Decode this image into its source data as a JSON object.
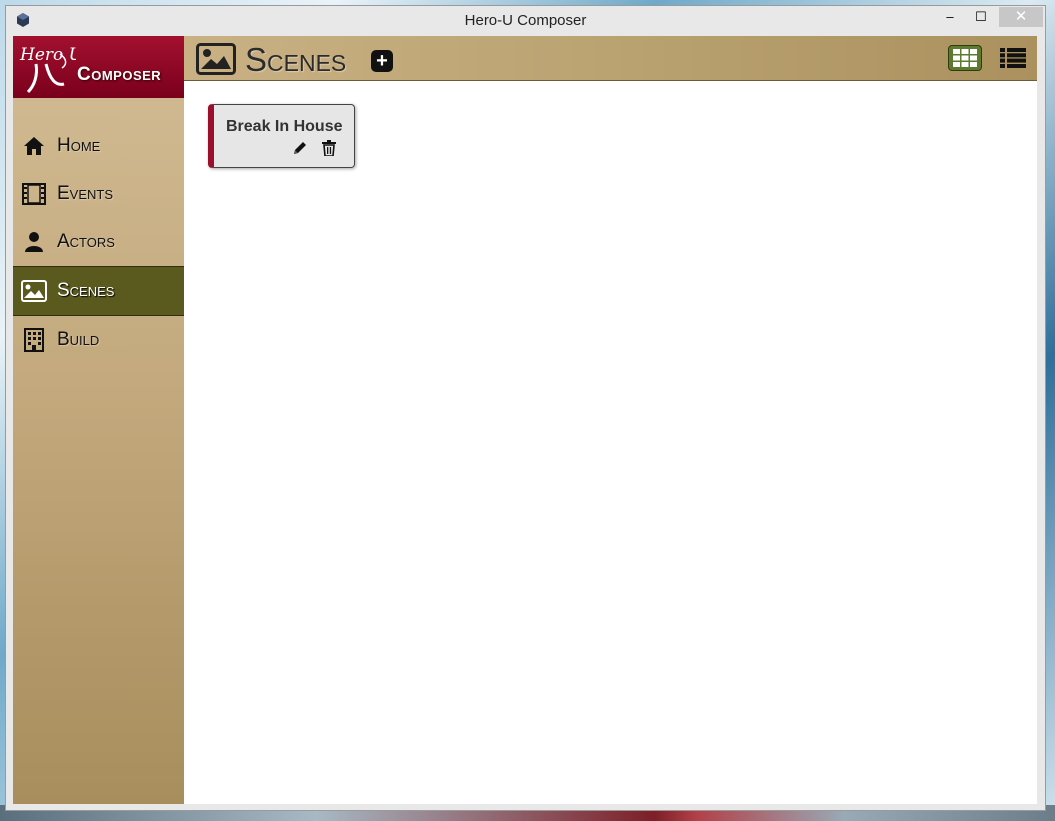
{
  "window": {
    "title": "Hero-U Composer",
    "minimize": "–",
    "maximize": "☐",
    "close": "✕"
  },
  "logo": {
    "brand_script": "Hero U",
    "text": "Composer"
  },
  "sidebar": {
    "items": [
      {
        "label": "Home",
        "icon": "home-icon",
        "active": false
      },
      {
        "label": "Events",
        "icon": "film-icon",
        "active": false
      },
      {
        "label": "Actors",
        "icon": "user-icon",
        "active": false
      },
      {
        "label": "Scenes",
        "icon": "image-icon",
        "active": true
      },
      {
        "label": "Build",
        "icon": "building-icon",
        "active": false
      }
    ]
  },
  "header": {
    "title": "Scenes",
    "add_label": "+",
    "view_modes": [
      "grid-view-icon",
      "list-view-icon"
    ],
    "active_view": "grid"
  },
  "scenes": [
    {
      "title": "Break In House"
    }
  ],
  "colors": {
    "accent_red": "#9b0f2c",
    "active_nav": "#5a5a1f",
    "grid_button": "#5d7a2e"
  }
}
